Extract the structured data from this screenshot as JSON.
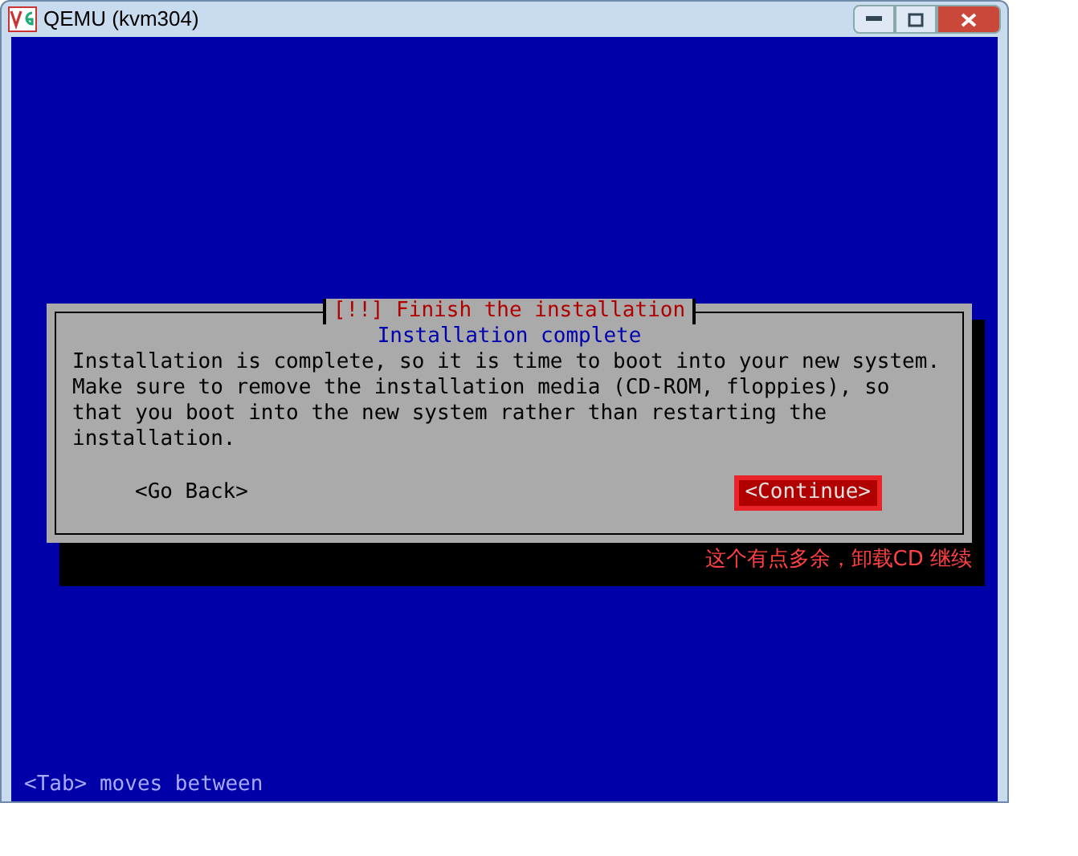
{
  "window": {
    "title": "QEMU (kvm304)"
  },
  "dialog": {
    "title": "[!!] Finish the installation",
    "subtitle": "Installation complete",
    "message": [
      "Installation is complete, so it is time to boot into your new system.",
      "Make sure to remove the installation media (CD-ROM, floppies), so",
      "that you boot into the new system rather than restarting the",
      "installation."
    ],
    "buttons": [
      {
        "label": "<Go Back>",
        "selected": false
      },
      {
        "label": "<Continue>",
        "selected": true
      }
    ]
  },
  "annotation": "这个有点多余，卸载CD 继续",
  "status_bar": "<Tab> moves between"
}
